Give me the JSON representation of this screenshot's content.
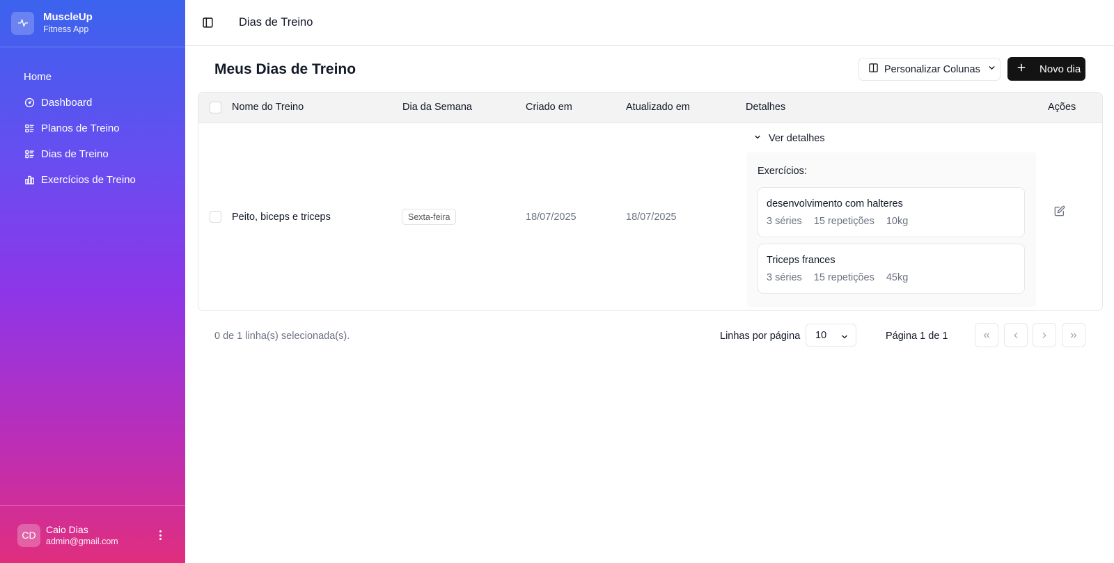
{
  "app": {
    "name": "MuscleUp",
    "subtitle": "Fitness App"
  },
  "sidebar": {
    "items": [
      {
        "label": "Home",
        "icon": "none"
      },
      {
        "label": "Dashboard",
        "icon": "gauge-icon"
      },
      {
        "label": "Planos de Treino",
        "icon": "list-icon"
      },
      {
        "label": "Dias de Treino",
        "icon": "list-icon"
      },
      {
        "label": "Exercícios de Treino",
        "icon": "bar-chart-icon"
      }
    ]
  },
  "user": {
    "initials": "CD",
    "name": "Caio Dias",
    "email": "admin@gmail.com"
  },
  "header": {
    "title": "Dias de Treino"
  },
  "main": {
    "title": "Meus Dias de Treino",
    "columns_button": "Personalizar Colunas",
    "new_button": "Novo dia"
  },
  "table": {
    "headers": [
      "Nome do Treino",
      "Dia da Semana",
      "Criado em",
      "Atualizado em",
      "Detalhes",
      "Ações"
    ],
    "rows": [
      {
        "name": "Peito, biceps e triceps",
        "weekday": "Sexta-feira",
        "created": "18/07/2025",
        "updated": "18/07/2025",
        "details_toggle": "Ver detalhes",
        "details_title": "Exercícios:",
        "exercises": [
          {
            "name": "desenvolvimento com halteres",
            "sets": "3 séries",
            "reps": "15 repetições",
            "weight": "10kg"
          },
          {
            "name": "Triceps frances",
            "sets": "3 séries",
            "reps": "15 repetições",
            "weight": "45kg"
          }
        ]
      }
    ]
  },
  "footer": {
    "selection": "0 de 1 linha(s) selecionada(s).",
    "rows_per_page_label": "Linhas por página",
    "rows_per_page_value": "10",
    "page_info": "Página 1 de 1"
  },
  "colors": {
    "accent": "#131313",
    "gradient_top": "#3b63ee",
    "gradient_bottom": "#e02e7e"
  }
}
